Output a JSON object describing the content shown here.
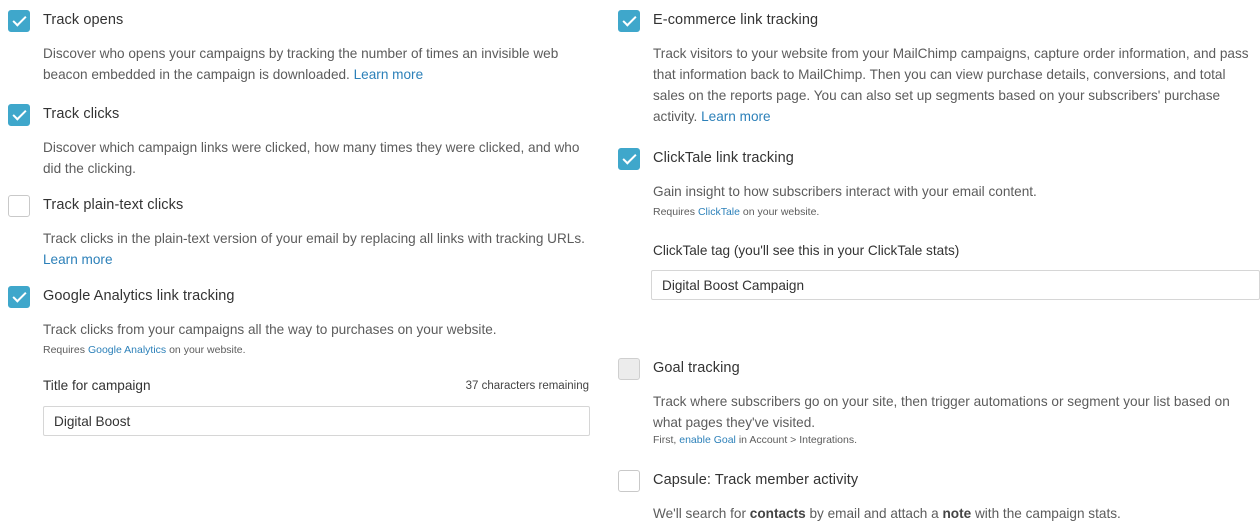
{
  "left": {
    "track_opens": {
      "label": "Track opens",
      "checked": true,
      "desc": "Discover who opens your campaigns by tracking the number of times an invisible web beacon embedded in the campaign is downloaded.",
      "link": "Learn more"
    },
    "track_clicks": {
      "label": "Track clicks",
      "checked": true,
      "desc": "Discover which campaign links were clicked, how many times they were clicked, and who did the clicking."
    },
    "track_plain": {
      "label": "Track plain-text clicks",
      "checked": false,
      "desc": "Track clicks in the plain-text version of your email by replacing all links with tracking URLs.",
      "link": "Learn more"
    },
    "google": {
      "label": "Google Analytics link tracking",
      "checked": true,
      "desc": "Track clicks from your campaigns all the way to purchases on your website.",
      "req_prefix": "Requires",
      "req_link": "Google Analytics",
      "req_suffix": "on your website.",
      "field_label": "Title for campaign",
      "remaining": "37 characters remaining",
      "value": "Digital Boost"
    }
  },
  "right": {
    "ecommerce": {
      "label": "E-commerce link tracking",
      "checked": true,
      "desc": "Track visitors to your website from your MailChimp campaigns, capture order information, and pass that information back to MailChimp. Then you can view purchase details, conversions, and total sales on the reports page. You can also set up segments based on your subscribers' purchase activity.",
      "link": "Learn more"
    },
    "clicktale": {
      "label": "ClickTale link tracking",
      "checked": true,
      "desc": "Gain insight to how subscribers interact with your email content.",
      "req_prefix": "Requires",
      "req_link": "ClickTale",
      "req_suffix": "on your website.",
      "field_label": "ClickTale tag (you'll see this in your ClickTale stats)",
      "value": "Digital Boost Campaign"
    },
    "goal": {
      "label": "Goal tracking",
      "checked": false,
      "desc": "Track where subscribers go on your site, then trigger automations or segment your list based on what pages they've visited.",
      "req_prefix": "First,",
      "req_link": "enable Goal",
      "req_suffix": "in Account > Integrations."
    },
    "capsule": {
      "label": "Capsule: Track member activity",
      "checked": false,
      "desc_a": "We'll search for",
      "desc_b": "contacts",
      "desc_c": "by email and attach a",
      "desc_d": "note",
      "desc_e": "with the campaign stats."
    }
  }
}
